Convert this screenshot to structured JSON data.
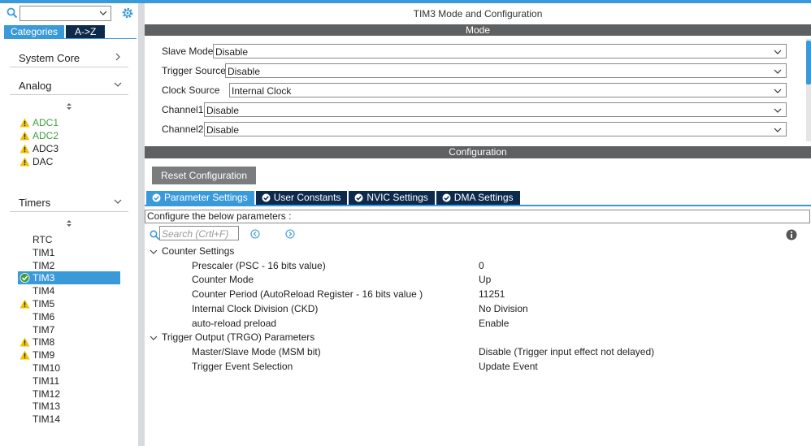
{
  "sidebar": {
    "categories_tab": "Categories",
    "az_tab": "A->Z",
    "groups": {
      "system_core": "System Core",
      "analog": "Analog",
      "timers": "Timers"
    },
    "analog_items": [
      {
        "label": "ADC1",
        "status": "warning",
        "color": "green"
      },
      {
        "label": "ADC2",
        "status": "warning",
        "color": "green"
      },
      {
        "label": "ADC3",
        "status": "warning",
        "color": "normal"
      },
      {
        "label": "DAC",
        "status": "warning",
        "color": "normal"
      }
    ],
    "timer_items": [
      {
        "label": "RTC",
        "status": "none"
      },
      {
        "label": "TIM1",
        "status": "none"
      },
      {
        "label": "TIM2",
        "status": "none"
      },
      {
        "label": "TIM3",
        "status": "ok",
        "selected": true
      },
      {
        "label": "TIM4",
        "status": "none"
      },
      {
        "label": "TIM5",
        "status": "warning"
      },
      {
        "label": "TIM6",
        "status": "none"
      },
      {
        "label": "TIM7",
        "status": "none"
      },
      {
        "label": "TIM8",
        "status": "warning"
      },
      {
        "label": "TIM9",
        "status": "warning"
      },
      {
        "label": "TIM10",
        "status": "none"
      },
      {
        "label": "TIM11",
        "status": "none"
      },
      {
        "label": "TIM12",
        "status": "none"
      },
      {
        "label": "TIM13",
        "status": "none"
      },
      {
        "label": "TIM14",
        "status": "none"
      }
    ]
  },
  "main": {
    "title": "TIM3 Mode and Configuration",
    "mode_header": "Mode",
    "mode_rows": [
      {
        "label": "Slave Mode",
        "value": "Disable"
      },
      {
        "label": "Trigger Source",
        "value": "Disable"
      },
      {
        "label": "Clock Source",
        "value": "Internal Clock"
      },
      {
        "label": "Channel1",
        "value": "Disable"
      },
      {
        "label": "Channel2",
        "value": "Disable"
      }
    ],
    "config_header": "Configuration",
    "reset_button": "Reset Configuration",
    "tabs": [
      {
        "label": "Parameter Settings",
        "active": true
      },
      {
        "label": "User Constants",
        "active": false
      },
      {
        "label": "NVIC Settings",
        "active": false
      },
      {
        "label": "DMA Settings",
        "active": false
      }
    ],
    "config_hint": "Configure the below parameters :",
    "search_placeholder": "Search (Crtl+F)",
    "groups": [
      {
        "label": "Counter Settings",
        "params": [
          {
            "name": "Prescaler (PSC - 16 bits value)",
            "value": "0"
          },
          {
            "name": "Counter Mode",
            "value": "Up"
          },
          {
            "name": "Counter Period (AutoReload Register - 16 bits value )",
            "value": "11251"
          },
          {
            "name": "Internal Clock Division (CKD)",
            "value": "No Division"
          },
          {
            "name": "auto-reload preload",
            "value": "Enable"
          }
        ]
      },
      {
        "label": "Trigger Output (TRGO) Parameters",
        "params": [
          {
            "name": "Master/Slave Mode (MSM bit)",
            "value": "Disable (Trigger input effect not delayed)"
          },
          {
            "name": "Trigger Event Selection",
            "value": "Update Event"
          }
        ]
      }
    ]
  },
  "colors": {
    "accent": "#3a9ad9",
    "dark_tab": "#0d2a4c",
    "section_bar": "#5f6061",
    "warning": "#f2c200",
    "ok_green": "#3f9e3f"
  }
}
